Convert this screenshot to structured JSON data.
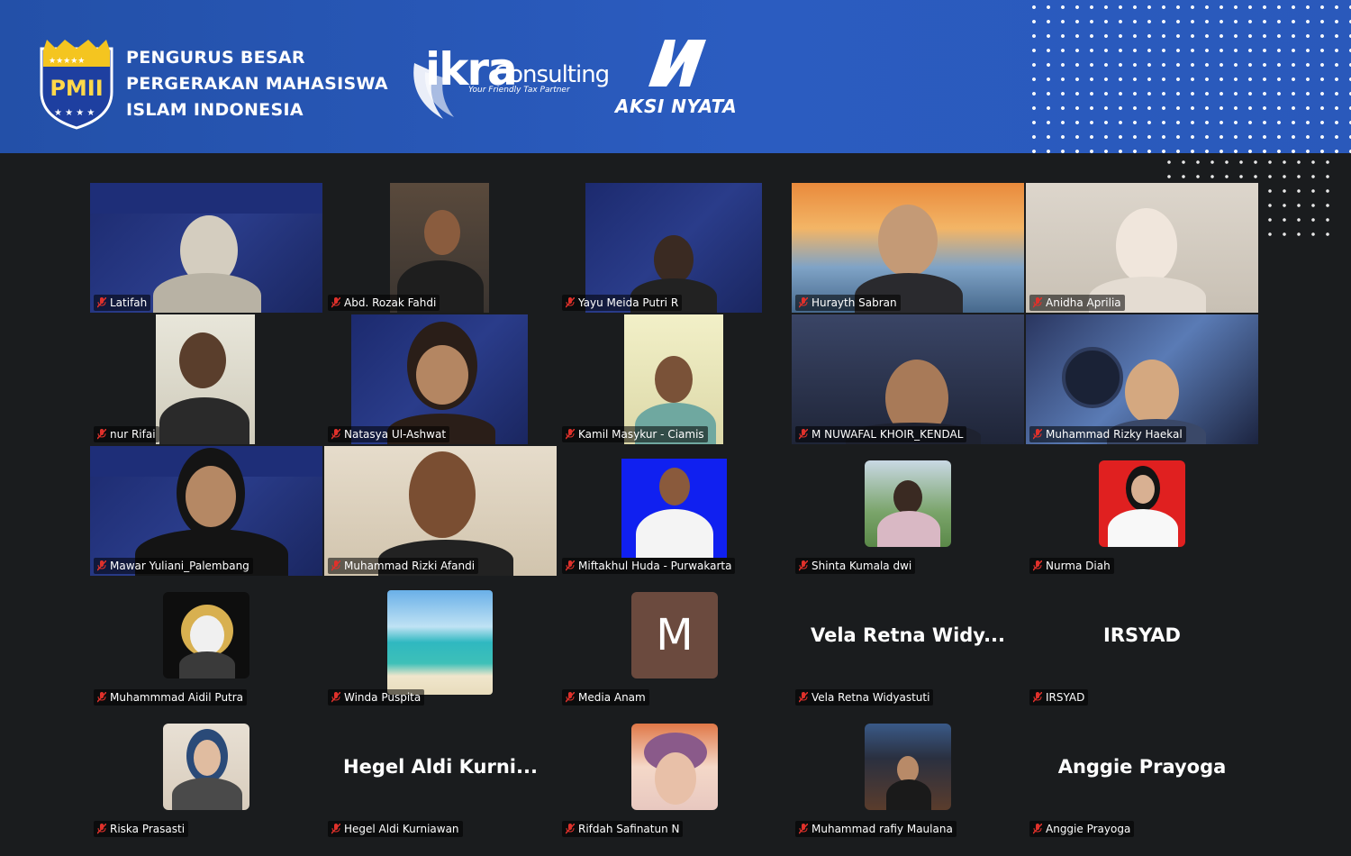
{
  "banner": {
    "org_name_line1": "PENGURUS BESAR",
    "org_name_line2": "PERGERAKAN MAHASISWA",
    "org_name_line3": "ISLAM INDONESIA",
    "shield_text": "PMII",
    "ikra_logo_main": "ikra",
    "ikra_logo_suffix": "Consulting",
    "ikra_tagline": "Your Friendly Tax Partner",
    "aksi_logo_text": "AKSI NYATA"
  },
  "participants": [
    {
      "name": "Latifah",
      "kind": "video"
    },
    {
      "name": "Abd. Rozak Fahdi",
      "kind": "video"
    },
    {
      "name": "Yayu Meida Putri R",
      "kind": "video"
    },
    {
      "name": "Hurayth Sabran",
      "kind": "video"
    },
    {
      "name": "Anidha Aprilia",
      "kind": "video"
    },
    {
      "name": "nur Rifai",
      "kind": "video"
    },
    {
      "name": "Natasya Ul-Ashwat",
      "kind": "video"
    },
    {
      "name": "Kamil Masykur - Ciamis",
      "kind": "video"
    },
    {
      "name": "M NUWAFAL KHOIR_KENDAL",
      "kind": "video"
    },
    {
      "name": "Muhammad Rizky Haekal",
      "kind": "video"
    },
    {
      "name": "Mawar Yuliani_Palembang",
      "kind": "video"
    },
    {
      "name": "Muhammad Rizki Afandi",
      "kind": "video"
    },
    {
      "name": "Miftakhul Huda - Purwakarta",
      "kind": "photo"
    },
    {
      "name": "Shinta Kumala dwi",
      "kind": "photo"
    },
    {
      "name": "Nurma Diah",
      "kind": "photo"
    },
    {
      "name": "Muhammmad Aidil Putra",
      "kind": "photo"
    },
    {
      "name": "Winda Puspita",
      "kind": "photo"
    },
    {
      "name": "Media Anam",
      "kind": "letter",
      "letter": "M"
    },
    {
      "name": "Vela Retna Widyastuti",
      "kind": "text",
      "display": "Vela Retna Widy..."
    },
    {
      "name": "IRSYAD",
      "kind": "text",
      "display": "IRSYAD"
    },
    {
      "name": "Riska Prasasti",
      "kind": "photo"
    },
    {
      "name": "Hegel Aldi Kurniawan",
      "kind": "text",
      "display": "Hegel Aldi Kurni..."
    },
    {
      "name": "Rifdah Safinatun N",
      "kind": "photo"
    },
    {
      "name": "Muhammad rafiy Maulana",
      "kind": "photo"
    },
    {
      "name": "Anggie Prayoga",
      "kind": "text",
      "display": "Anggie Prayoga"
    }
  ],
  "colors": {
    "banner_blue": "#2a59bb",
    "background": "#1a1c1e",
    "mic_muted": "#e0312b",
    "avatar_letter_bg": "#6b4a3e"
  }
}
